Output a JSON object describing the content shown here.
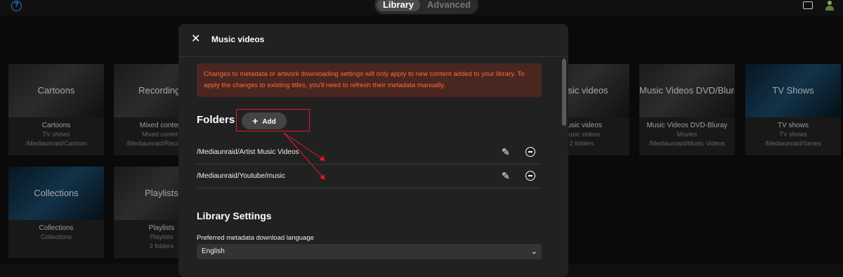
{
  "topbar": {
    "help_icon": "question-circle-icon",
    "tabs": [
      {
        "label": "Library",
        "active": true
      },
      {
        "label": "Advanced",
        "active": false
      }
    ],
    "cast_icon": "cast-icon",
    "user_icon": "user-avatar-icon"
  },
  "libraries": [
    {
      "thumb": "Cartoons",
      "title": "Cartoons",
      "type": "TV shows",
      "path": "/Mediaunraid/Cartoon"
    },
    {
      "thumb": "Recordings",
      "title": "Mixed content",
      "type": "Mixed content",
      "path": "/Mediaunraid/Recordings"
    },
    {
      "thumb": "Music videos",
      "title": "Music videos",
      "type": "Music videos",
      "path": "2 folders"
    },
    {
      "thumb": "Music Videos DVD/Bluray",
      "title": "Music Videos DVD-Bluray",
      "type": "Movies",
      "path": "/Mediaunraid/Music Videos"
    },
    {
      "thumb": "TV Shows",
      "title": "TV shows",
      "type": "TV shows",
      "path": "/Mediaunraid/Series"
    },
    {
      "thumb": "Collections",
      "title": "Collections",
      "type": "Collections",
      "path": ""
    },
    {
      "thumb": "Playlists",
      "title": "Playlists",
      "type": "Playlists",
      "path": "2 folders"
    }
  ],
  "modal": {
    "title": "Music videos",
    "close_icon": "close-icon",
    "warning": "Changes to metadata or artwork downloading settings will only apply to new content added to your library. To apply the changes to existing titles, you'll need to refresh their metadata manually.",
    "folders_heading": "Folders",
    "add_label": "Add",
    "folders": [
      {
        "path": "/Mediaunraid/Artist Music Videos"
      },
      {
        "path": "/Mediaunraid/Youtube/music"
      }
    ],
    "library_settings_heading": "Library Settings",
    "language_label": "Preferred metadata download language",
    "language_value": "English"
  },
  "colors": {
    "warning_text": "#ff6a3d",
    "warning_bg": "#4a2620",
    "annotation": "#e0192b",
    "accent": "#2f7fdc"
  }
}
